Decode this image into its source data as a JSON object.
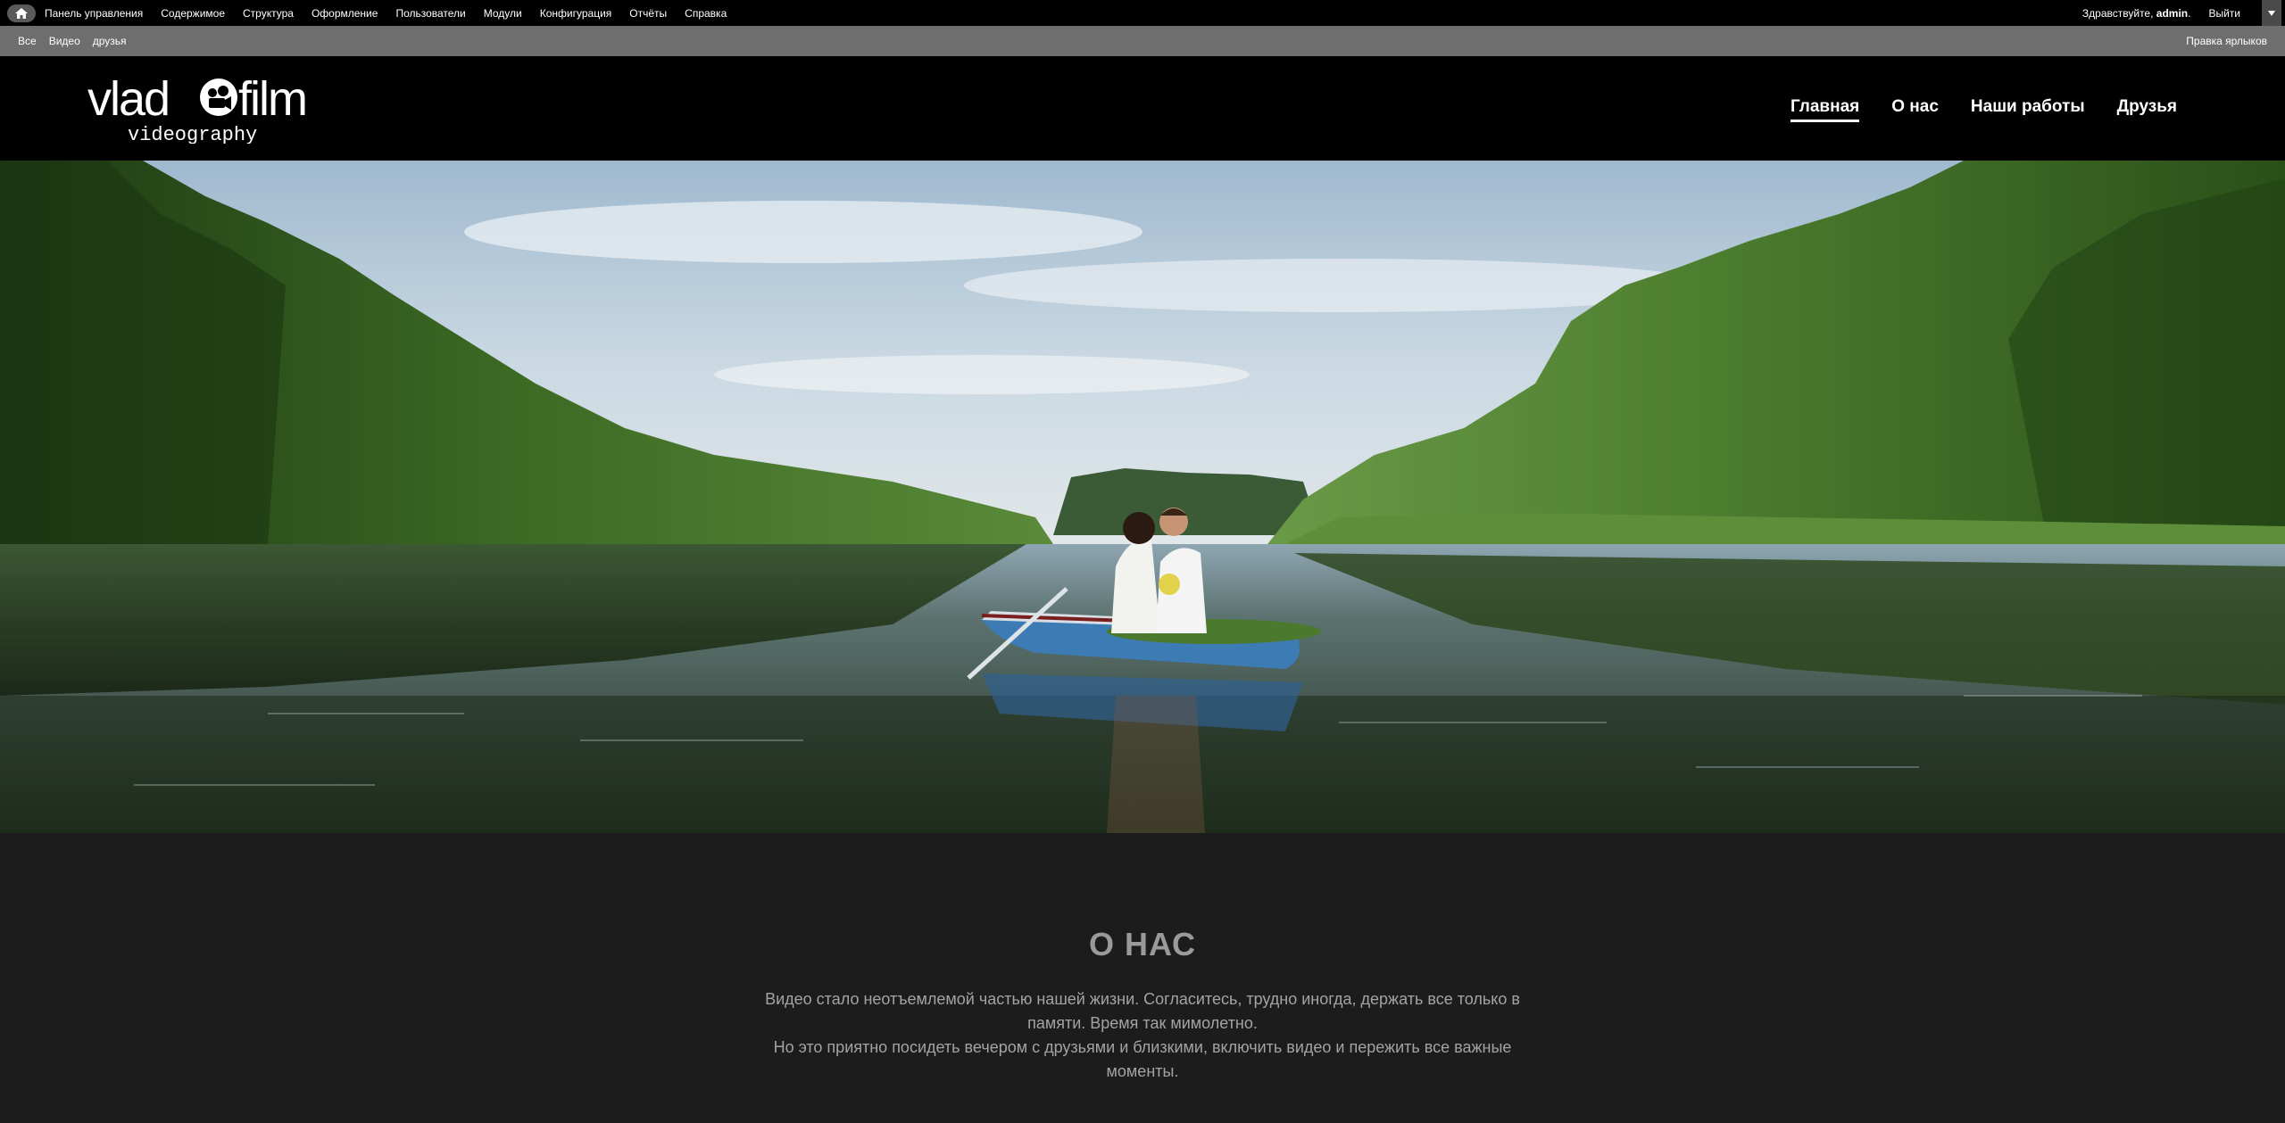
{
  "admin_bar": {
    "menu": [
      "Панель управления",
      "Содержимое",
      "Структура",
      "Оформление",
      "Пользователи",
      "Модули",
      "Конфигурация",
      "Отчёты",
      "Справка"
    ],
    "greeting_prefix": "Здравствуйте, ",
    "username": "admin",
    "greeting_suffix": ".",
    "logout_label": "Выйти"
  },
  "shortcuts": {
    "items": [
      "Все",
      "Видео",
      "друзья"
    ],
    "edit_label": "Правка ярлыков"
  },
  "logo": {
    "text_left": "vlad",
    "text_right": "film",
    "tagline": "videography"
  },
  "nav": {
    "items": [
      "Главная",
      "О нас",
      "Наши работы",
      "Друзья"
    ],
    "active": "Главная"
  },
  "about": {
    "title": "О НАС",
    "paragraph_1": "Видео стало неотъемлемой частью нашей жизни. Согласитесь, трудно иногда, держать все только в памяти. Время так мимолетно.",
    "paragraph_2": "Но это приятно посидеть вечером с друзьями и близкими, включить видео и пережить все важные моменты."
  },
  "colors": {
    "admin_bar_bg": "#000000",
    "shortcut_bar_bg": "#6e6e6e",
    "header_bg": "#000000",
    "body_bg": "#1c1c1c",
    "heading_color": "#9a9a9a",
    "text_color": "#a3a3a3"
  },
  "icons": {
    "home": "home-icon",
    "toggle": "chevron-down-icon",
    "logo_camera": "film-camera-icon"
  }
}
